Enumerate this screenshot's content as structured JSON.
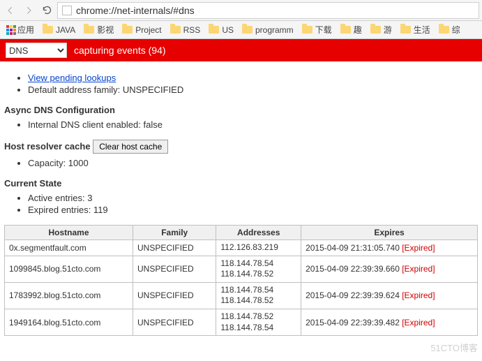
{
  "browser": {
    "url": "chrome://net-internals/#dns",
    "bookmarks": [
      "应用",
      "JAVA",
      "影视",
      "Project",
      "RSS",
      "US",
      "programm",
      "下载",
      "趣",
      "游",
      "生活",
      "综"
    ]
  },
  "banner": {
    "selected_module": "DNS",
    "status": "capturing events (94)"
  },
  "top_links": {
    "pending": "View pending lookups",
    "family": "Default address family: UNSPECIFIED"
  },
  "async_section": {
    "title": "Async DNS Configuration",
    "item": "Internal DNS client enabled: false"
  },
  "resolver": {
    "label": "Host resolver cache",
    "button": "Clear host cache",
    "capacity": "Capacity: 1000"
  },
  "state": {
    "title": "Current State",
    "active": "Active entries: 3",
    "expired": "Expired entries: 119"
  },
  "table": {
    "headers": [
      "Hostname",
      "Family",
      "Addresses",
      "Expires"
    ],
    "expired_tag": "[Expired]",
    "rows": [
      {
        "host": "0x.segmentfault.com",
        "family": "UNSPECIFIED",
        "addr": "112.126.83.219",
        "expires": "2015-04-09 21:31:05.740"
      },
      {
        "host": "1099845.blog.51cto.com",
        "family": "UNSPECIFIED",
        "addr": "118.144.78.54\n118.144.78.52",
        "expires": "2015-04-09 22:39:39.660"
      },
      {
        "host": "1783992.blog.51cto.com",
        "family": "UNSPECIFIED",
        "addr": "118.144.78.54\n118.144.78.52",
        "expires": "2015-04-09 22:39:39.624"
      },
      {
        "host": "1949164.blog.51cto.com",
        "family": "UNSPECIFIED",
        "addr": "118.144.78.52\n118.144.78.54",
        "expires": "2015-04-09 22:39:39.482"
      }
    ]
  },
  "watermark": "51CTO博客"
}
